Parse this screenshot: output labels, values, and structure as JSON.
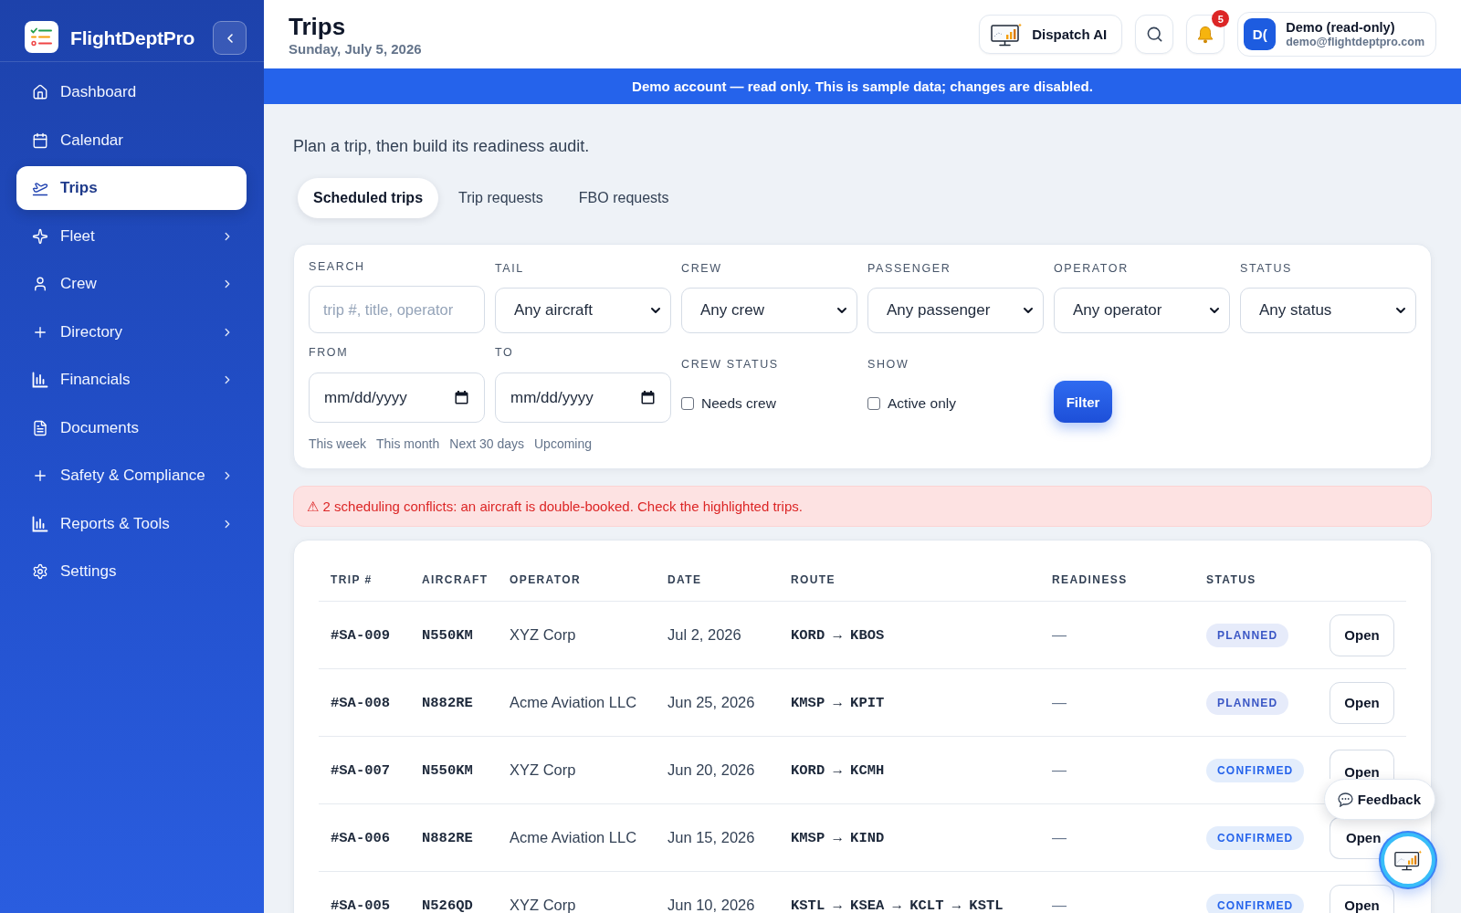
{
  "sidebar": {
    "brand": "FlightDeptPro",
    "items": [
      {
        "label": "Dashboard",
        "selected": false,
        "expandable": false
      },
      {
        "label": "Calendar",
        "selected": false,
        "expandable": false
      },
      {
        "label": "Trips",
        "selected": true,
        "expandable": false
      },
      {
        "label": "Fleet",
        "selected": false,
        "expandable": true
      },
      {
        "label": "Crew",
        "selected": false,
        "expandable": true
      },
      {
        "label": "Directory",
        "selected": false,
        "expandable": true
      },
      {
        "label": "Financials",
        "selected": false,
        "expandable": true
      },
      {
        "label": "Documents",
        "selected": false,
        "expandable": false
      },
      {
        "label": "Safety & Compliance",
        "selected": false,
        "expandable": true
      },
      {
        "label": "Reports & Tools",
        "selected": false,
        "expandable": true
      },
      {
        "label": "Settings",
        "selected": false,
        "expandable": false
      }
    ]
  },
  "header": {
    "title": "Trips",
    "date": "Sunday, July 5, 2026",
    "assistant_button": "Dispatch AI",
    "notification_count": "5",
    "user": {
      "initials": "D(",
      "name": "Demo (read-only)",
      "email": "demo@flightdeptpro.com"
    }
  },
  "banner": "Demo account — read only. This is sample data; changes are disabled.",
  "intro": "Plan a trip, then build its readiness audit.",
  "tabs": [
    {
      "label": "Scheduled trips",
      "selected": true
    },
    {
      "label": "Trip requests",
      "selected": false
    },
    {
      "label": "FBO requests",
      "selected": false
    }
  ],
  "filters": {
    "fields": [
      {
        "kind": "text",
        "label": "SEARCH",
        "placeholder": "trip #, title, operator"
      },
      {
        "kind": "select",
        "label": "TAIL",
        "value": "Any aircraft"
      },
      {
        "kind": "select",
        "label": "CREW",
        "value": "Any crew"
      },
      {
        "kind": "select",
        "label": "PASSENGER",
        "value": "Any passenger"
      },
      {
        "kind": "select",
        "label": "OPERATOR",
        "value": "Any operator"
      },
      {
        "kind": "select",
        "label": "STATUS",
        "value": "Any status"
      },
      {
        "kind": "date",
        "label": "FROM",
        "placeholder": "mm/dd/yyyy"
      },
      {
        "kind": "date",
        "label": "TO",
        "placeholder": "mm/dd/yyyy"
      },
      {
        "kind": "checkbox",
        "label": "CREW STATUS",
        "option": "Needs crew",
        "checked": false
      },
      {
        "kind": "checkbox",
        "label": "SHOW",
        "option": "Active only",
        "checked": false
      }
    ],
    "button": "Filter",
    "quick_ranges": [
      "This week",
      "This month",
      "Next 30 days",
      "Upcoming"
    ]
  },
  "alert": "⚠ 2 scheduling conflicts: an aircraft is double-booked. Check the highlighted trips.",
  "table": {
    "columns": [
      "TRIP #",
      "AIRCRAFT",
      "OPERATOR",
      "DATE",
      "ROUTE",
      "READINESS",
      "STATUS"
    ],
    "rows": [
      {
        "trip": "#SA-009",
        "aircraft": "N550KM",
        "operator": "XYZ Corp",
        "date": "Jul 2, 2026",
        "route": "KORD → KBOS",
        "readiness": "—",
        "status": {
          "label": "PLANNED",
          "kind": "planned"
        },
        "action": "Open"
      },
      {
        "trip": "#SA-008",
        "aircraft": "N882RE",
        "operator": "Acme Aviation LLC",
        "date": "Jun 25, 2026",
        "route": "KMSP → KPIT",
        "readiness": "—",
        "status": {
          "label": "PLANNED",
          "kind": "planned"
        },
        "action": "Open"
      },
      {
        "trip": "#SA-007",
        "aircraft": "N550KM",
        "operator": "XYZ Corp",
        "date": "Jun 20, 2026",
        "route": "KORD → KCMH",
        "readiness": "—",
        "status": {
          "label": "CONFIRMED",
          "kind": "confirmed"
        },
        "action": "Open"
      },
      {
        "trip": "#SA-006",
        "aircraft": "N882RE",
        "operator": "Acme Aviation LLC",
        "date": "Jun 15, 2026",
        "route": "KMSP → KIND",
        "readiness": "—",
        "status": {
          "label": "CONFIRMED",
          "kind": "confirmed"
        },
        "action": "Open"
      },
      {
        "trip": "#SA-005",
        "aircraft": "N526QD",
        "operator": "XYZ Corp",
        "date": "Jun 10, 2026",
        "route": "KSTL → KSEA → KCLT → KSTL",
        "readiness": "—",
        "status": {
          "label": "CONFIRMED",
          "kind": "confirmed"
        },
        "action": "Open"
      }
    ]
  },
  "feedback_button": "Feedback"
}
